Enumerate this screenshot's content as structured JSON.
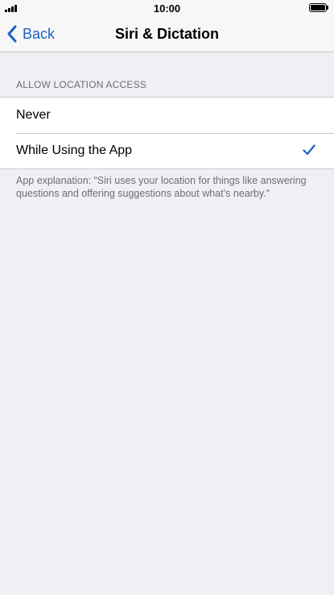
{
  "status_bar": {
    "time": "10:00",
    "signal_icon": "cellular-signal-icon",
    "battery_icon": "battery-full-icon"
  },
  "nav": {
    "back_label": "Back",
    "back_icon": "chevron-left-icon",
    "title": "Siri & Dictation"
  },
  "location_access": {
    "header": "ALLOW LOCATION ACCESS",
    "options": [
      {
        "label": "Never",
        "selected": false
      },
      {
        "label": "While Using the App",
        "selected": true
      }
    ],
    "check_icon": "checkmark-icon",
    "footer": "App explanation: “Siri uses your location for things like answering questions and offering suggestions about what’s nearby.”"
  },
  "colors": {
    "accent": "#1a61c6",
    "background": "#efeff4",
    "secondary_text": "#6d6d72"
  }
}
